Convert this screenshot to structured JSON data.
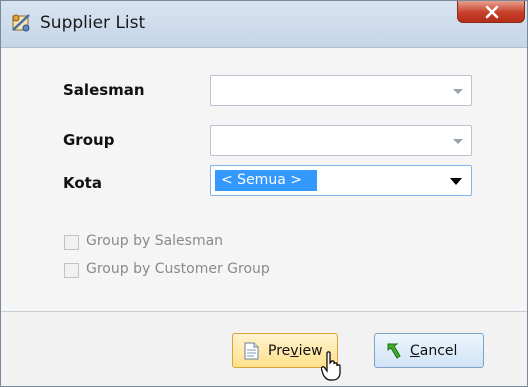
{
  "window": {
    "title": "Supplier List"
  },
  "form": {
    "salesman": {
      "label": "Salesman",
      "value": ""
    },
    "group": {
      "label": "Group",
      "value": ""
    },
    "kota": {
      "label": "Kota",
      "value": "< Semua >"
    }
  },
  "options": {
    "group_by_salesman": {
      "label": "Group by Salesman",
      "checked": false
    },
    "group_by_customer_group": {
      "label": "Group by Customer Group",
      "checked": false
    }
  },
  "buttons": {
    "preview": {
      "label_prefix": "Pre",
      "label_accel": "v",
      "label_suffix": "iew"
    },
    "cancel": {
      "label_accel": "C",
      "label_suffix": "ancel"
    }
  },
  "colors": {
    "selection": "#3399ff",
    "preview_button": "#ffe08a",
    "cancel_button": "#cfe3f5",
    "close_button": "#c8402b"
  },
  "icons": {
    "title": "report-settings-icon",
    "close": "close-icon",
    "preview": "document-icon",
    "cancel": "green-arrow-icon"
  }
}
